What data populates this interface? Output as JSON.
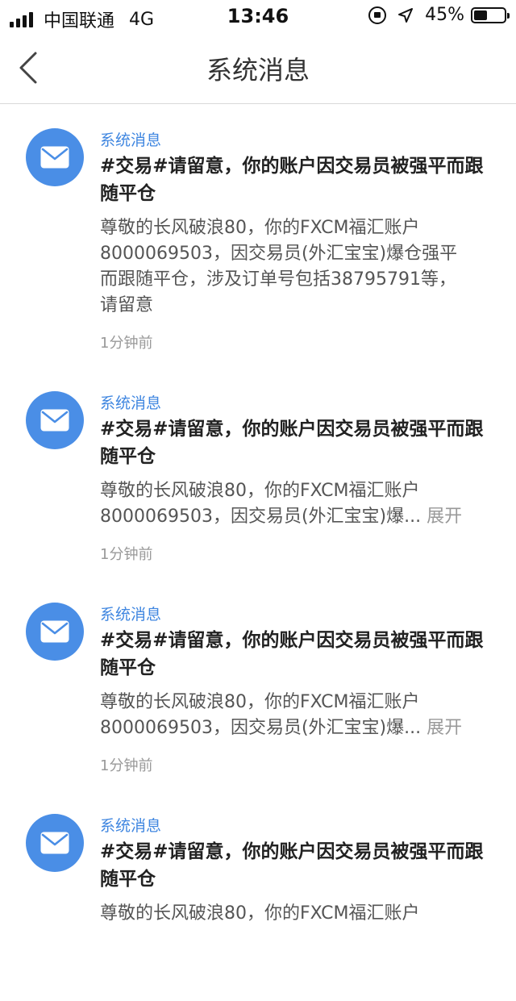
{
  "status_bar": {
    "carrier": "中国联通",
    "network": "4G",
    "time": "13:46",
    "battery": "45%",
    "battery_level": 0.45
  },
  "nav": {
    "title": "系统消息"
  },
  "messages": [
    {
      "source": "系统消息",
      "title": "#交易#请留意，你的账户因交易员被强平而跟随平仓",
      "body_lines": [
        "尊敬的长风破浪80，你的FXCM福汇账户",
        "8000069503，因交易员(外汇宝宝)爆仓强平",
        "而跟随平仓，涉及订单号包括38795791等，",
        "请留意"
      ],
      "expand_label": "",
      "time": "1分钟前"
    },
    {
      "source": "系统消息",
      "title": "#交易#请留意，你的账户因交易员被强平而跟随平仓",
      "body_lines": [
        "尊敬的长风破浪80，你的FXCM福汇账户",
        "8000069503，因交易员(外汇宝宝)爆..."
      ],
      "expand_label": "展开",
      "time": "1分钟前"
    },
    {
      "source": "系统消息",
      "title": "#交易#请留意，你的账户因交易员被强平而跟随平仓",
      "body_lines": [
        "尊敬的长风破浪80，你的FXCM福汇账户",
        "8000069503，因交易员(外汇宝宝)爆..."
      ],
      "expand_label": "展开",
      "time": "1分钟前"
    },
    {
      "source": "系统消息",
      "title": "#交易#请留意，你的账户因交易员被强平而跟随平仓",
      "body_lines": [
        "尊敬的长风破浪80，你的FXCM福汇账户"
      ],
      "expand_label": "",
      "time": ""
    }
  ]
}
